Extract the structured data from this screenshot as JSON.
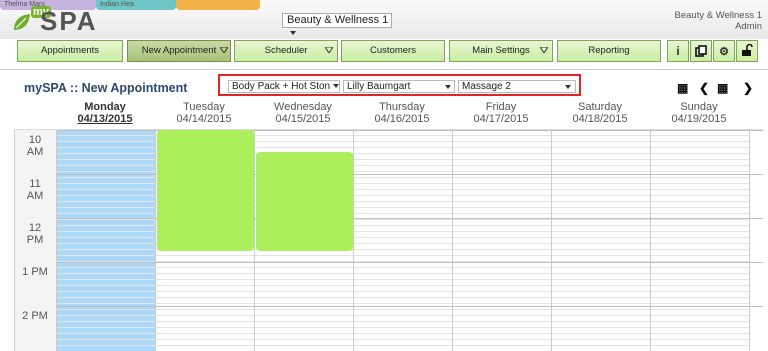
{
  "bg_tabs": [
    {
      "label": "Thelma Mars",
      "color": "#c4b4de"
    },
    {
      "label": "Indian Hea",
      "color": "#6fc4c4"
    },
    {
      "label": "",
      "color": "#f2b24a"
    }
  ],
  "logo": {
    "prefix": "my",
    "name": "SPA"
  },
  "location": {
    "selected": "Beauty & Wellness 1"
  },
  "user": {
    "location": "Beauty & Wellness 1",
    "role": "Admin"
  },
  "nav": [
    {
      "label": "Appointments",
      "dropdown": false,
      "active": false
    },
    {
      "label": "New Appointment",
      "dropdown": true,
      "active": true
    },
    {
      "label": "Scheduler",
      "dropdown": true,
      "active": false
    },
    {
      "label": "Customers",
      "dropdown": false,
      "active": false
    },
    {
      "label": "Main Settings",
      "dropdown": true,
      "active": false
    },
    {
      "label": "Reporting",
      "dropdown": false,
      "active": false
    }
  ],
  "icons": [
    "info-icon",
    "copy-icon",
    "settings-icon",
    "unlock-icon"
  ],
  "page_title": "mySPA :: New Appointment",
  "filters": {
    "service": "Body Pack + Hot Ston",
    "staff": "Lilly Baumgart",
    "resource": "Massage 2"
  },
  "days": [
    {
      "name": "Monday",
      "date": "04/13/2015",
      "current": true
    },
    {
      "name": "Tuesday",
      "date": "04/14/2015",
      "current": false
    },
    {
      "name": "Wednesday",
      "date": "04/15/2015",
      "current": false
    },
    {
      "name": "Thursday",
      "date": "04/16/2015",
      "current": false
    },
    {
      "name": "Friday",
      "date": "04/17/2015",
      "current": false
    },
    {
      "name": "Saturday",
      "date": "04/18/2015",
      "current": false
    },
    {
      "name": "Sunday",
      "date": "04/19/2015",
      "current": false
    }
  ],
  "hours": [
    {
      "l1": "10",
      "l2": "AM"
    },
    {
      "l1": "11",
      "l2": "AM"
    },
    {
      "l1": "12",
      "l2": "PM"
    },
    {
      "l1": "1 PM",
      "l2": ""
    },
    {
      "l1": "2 PM",
      "l2": ""
    }
  ],
  "availability": [
    {
      "day": 1,
      "start_hour": 10.0,
      "end_hour": 12.75
    },
    {
      "day": 2,
      "start_hour": 10.5,
      "end_hour": 12.75
    }
  ]
}
